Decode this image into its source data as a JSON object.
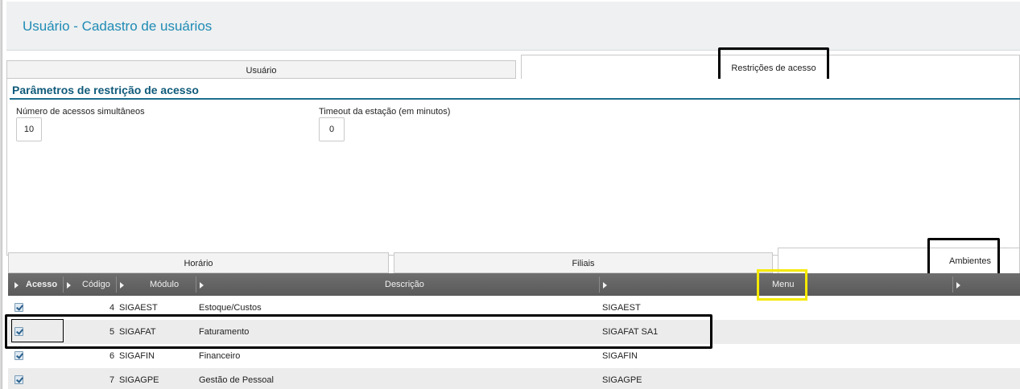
{
  "page": {
    "title": "Usuário - Cadastro de usuários"
  },
  "top_tabs": [
    {
      "label": "Usuário"
    },
    {
      "label": "Restrições de acesso"
    }
  ],
  "section": {
    "title": "Parâmetros de restrição de acesso"
  },
  "fields": {
    "simultaneous": {
      "label": "Número de acessos simultâneos",
      "value": "10"
    },
    "timeout": {
      "label": "Timeout da estação (em minutos)",
      "value": "0"
    }
  },
  "bottom_tabs": [
    {
      "label": "Horário"
    },
    {
      "label": "Filiais"
    },
    {
      "label": "Ambientes"
    }
  ],
  "grid": {
    "columns": {
      "acesso": "Acesso",
      "codigo": "Código",
      "modulo": "Módulo",
      "descricao": "Descrição",
      "menu": "Menu"
    },
    "rows": [
      {
        "acesso": true,
        "codigo": "4",
        "modulo": "SIGAEST",
        "descricao": "Estoque/Custos",
        "menu": "SIGAEST"
      },
      {
        "acesso": true,
        "codigo": "5",
        "modulo": "SIGAFAT",
        "descricao": "Faturamento",
        "menu": "SIGAFAT SA1"
      },
      {
        "acesso": true,
        "codigo": "6",
        "modulo": "SIGAFIN",
        "descricao": "Financeiro",
        "menu": "SIGAFIN"
      },
      {
        "acesso": true,
        "codigo": "7",
        "modulo": "SIGAGPE",
        "descricao": "Gestão de Pessoal",
        "menu": "SIGAGPE"
      }
    ]
  },
  "colors": {
    "title": "#1f8bb5",
    "section_title": "#0f5a7a",
    "highlight_box": "#000000",
    "highlight_menu": "#f5ea00"
  }
}
